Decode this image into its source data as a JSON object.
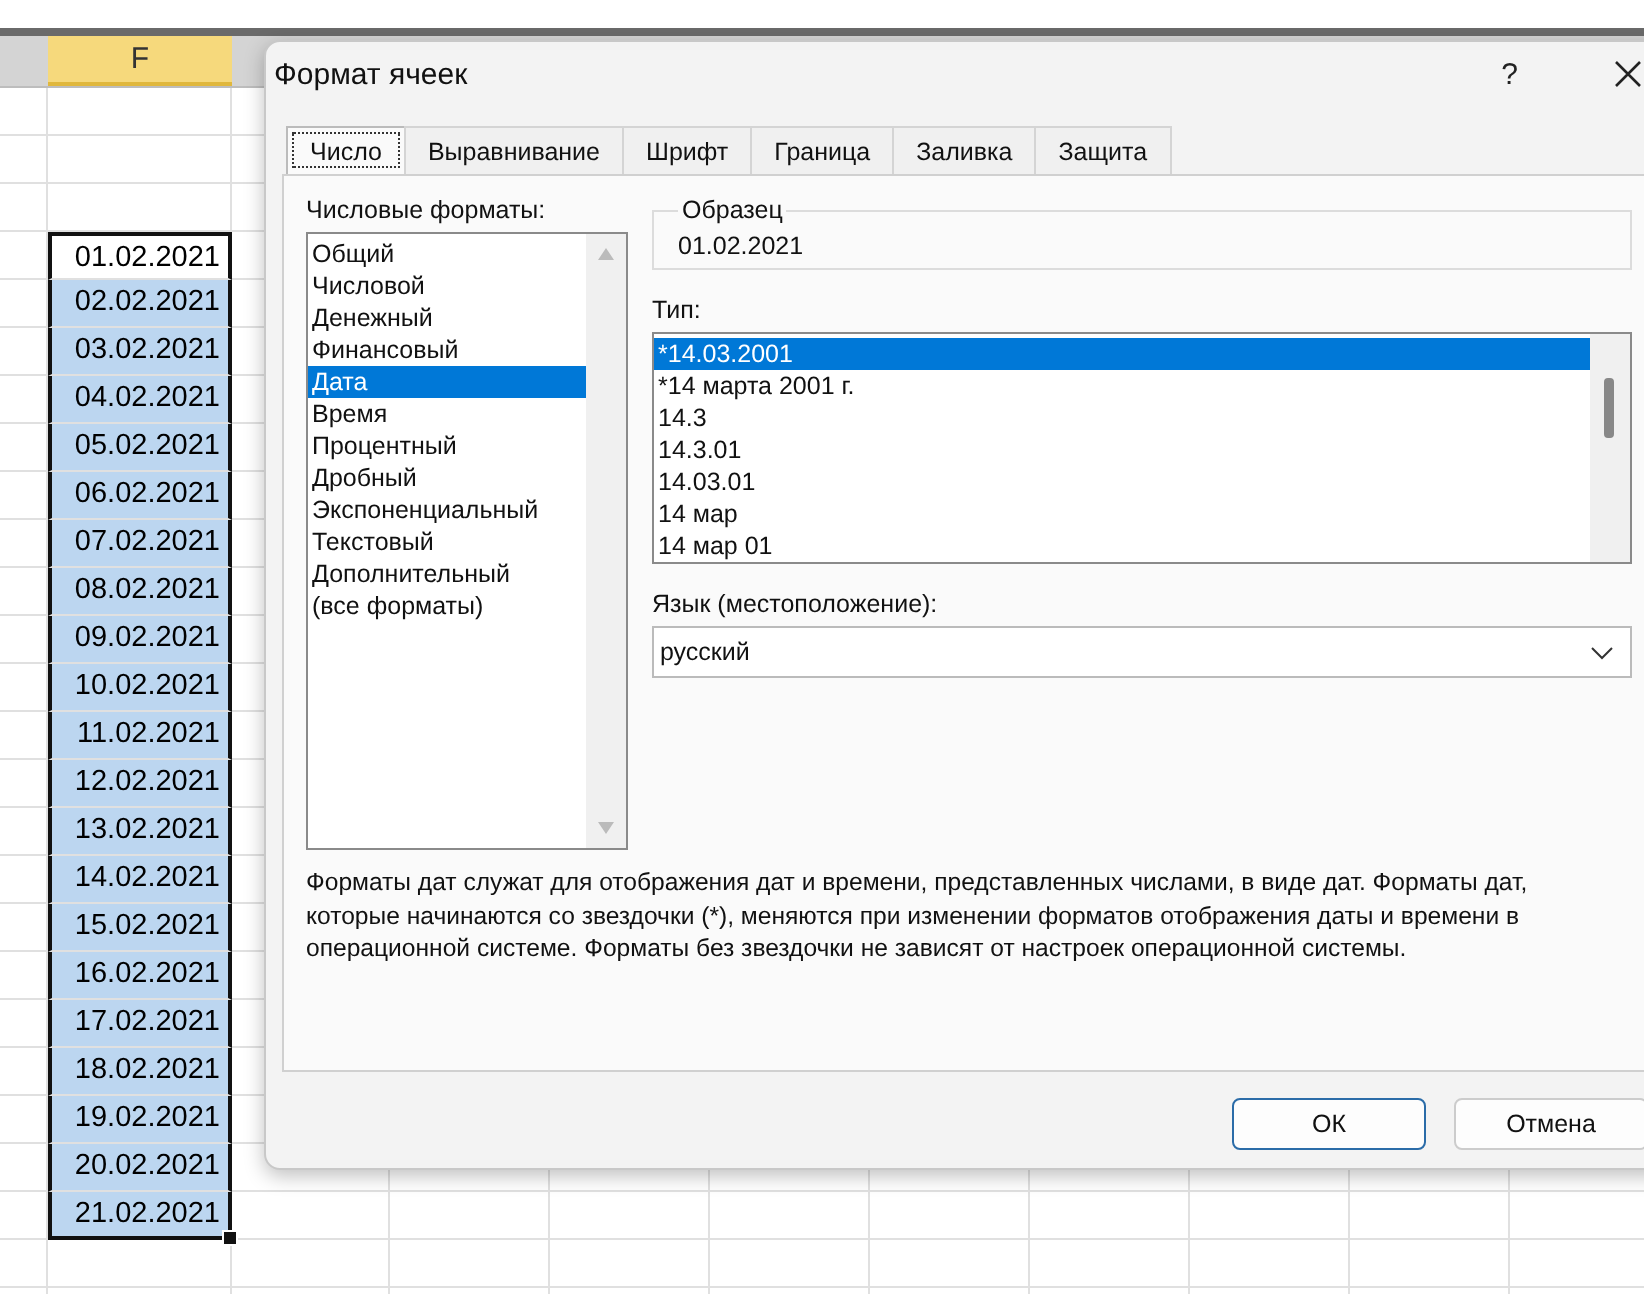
{
  "sheet": {
    "column_header": "F",
    "cells": [
      {
        "text": "01.02.2021",
        "selected": true,
        "active": true
      },
      {
        "text": "02.02.2021",
        "selected": true,
        "active": false
      },
      {
        "text": "03.02.2021",
        "selected": true,
        "active": false
      },
      {
        "text": "04.02.2021",
        "selected": true,
        "active": false
      },
      {
        "text": "05.02.2021",
        "selected": true,
        "active": false
      },
      {
        "text": "06.02.2021",
        "selected": true,
        "active": false
      },
      {
        "text": "07.02.2021",
        "selected": true,
        "active": false
      },
      {
        "text": "08.02.2021",
        "selected": true,
        "active": false
      },
      {
        "text": "09.02.2021",
        "selected": true,
        "active": false
      },
      {
        "text": "10.02.2021",
        "selected": true,
        "active": false
      },
      {
        "text": "11.02.2021",
        "selected": true,
        "active": false
      },
      {
        "text": "12.02.2021",
        "selected": true,
        "active": false
      },
      {
        "text": "13.02.2021",
        "selected": true,
        "active": false
      },
      {
        "text": "14.02.2021",
        "selected": true,
        "active": false
      },
      {
        "text": "15.02.2021",
        "selected": true,
        "active": false
      },
      {
        "text": "16.02.2021",
        "selected": true,
        "active": false
      },
      {
        "text": "17.02.2021",
        "selected": true,
        "active": false
      },
      {
        "text": "18.02.2021",
        "selected": true,
        "active": false
      },
      {
        "text": "19.02.2021",
        "selected": true,
        "active": false
      },
      {
        "text": "20.02.2021",
        "selected": true,
        "active": false
      },
      {
        "text": "21.02.2021",
        "selected": true,
        "active": false
      }
    ]
  },
  "dialog": {
    "title": "Формат ячеек",
    "help": "?",
    "tabs": [
      {
        "label": "Число",
        "selected": true
      },
      {
        "label": "Выравнивание",
        "selected": false
      },
      {
        "label": "Шрифт",
        "selected": false
      },
      {
        "label": "Граница",
        "selected": false
      },
      {
        "label": "Заливка",
        "selected": false
      },
      {
        "label": "Защита",
        "selected": false
      }
    ],
    "formats_label": "Числовые форматы:",
    "formats": [
      {
        "label": "Общий",
        "selected": false
      },
      {
        "label": "Числовой",
        "selected": false
      },
      {
        "label": "Денежный",
        "selected": false
      },
      {
        "label": "Финансовый",
        "selected": false
      },
      {
        "label": "Дата",
        "selected": true
      },
      {
        "label": "Время",
        "selected": false
      },
      {
        "label": "Процентный",
        "selected": false
      },
      {
        "label": "Дробный",
        "selected": false
      },
      {
        "label": "Экспоненциальный",
        "selected": false
      },
      {
        "label": "Текстовый",
        "selected": false
      },
      {
        "label": "Дополнительный",
        "selected": false
      },
      {
        "label": "(все форматы)",
        "selected": false
      }
    ],
    "sample": {
      "legend": "Образец",
      "value": "01.02.2021"
    },
    "type_label": "Тип:",
    "types": [
      {
        "label": "*14.03.2001",
        "selected": true
      },
      {
        "label": "*14 марта 2001 г.",
        "selected": false
      },
      {
        "label": "14.3",
        "selected": false
      },
      {
        "label": "14.3.01",
        "selected": false
      },
      {
        "label": "14.03.01",
        "selected": false
      },
      {
        "label": "14 мар",
        "selected": false
      },
      {
        "label": "14 мар 01",
        "selected": false
      }
    ],
    "locale_label": "Язык (местоположение):",
    "locale": "русский",
    "description": "Форматы дат служат для отображения дат и времени, представленных числами, в виде дат. Форматы дат, которые начинаются со звездочки (*), меняются при изменении форматов отображения даты и времени в операционной системе. Форматы без звездочки не зависят от настроек операционной системы.",
    "buttons": [
      {
        "label": "ОК",
        "kind": "primary"
      },
      {
        "label": "Отмена",
        "kind": "secondary"
      }
    ]
  }
}
